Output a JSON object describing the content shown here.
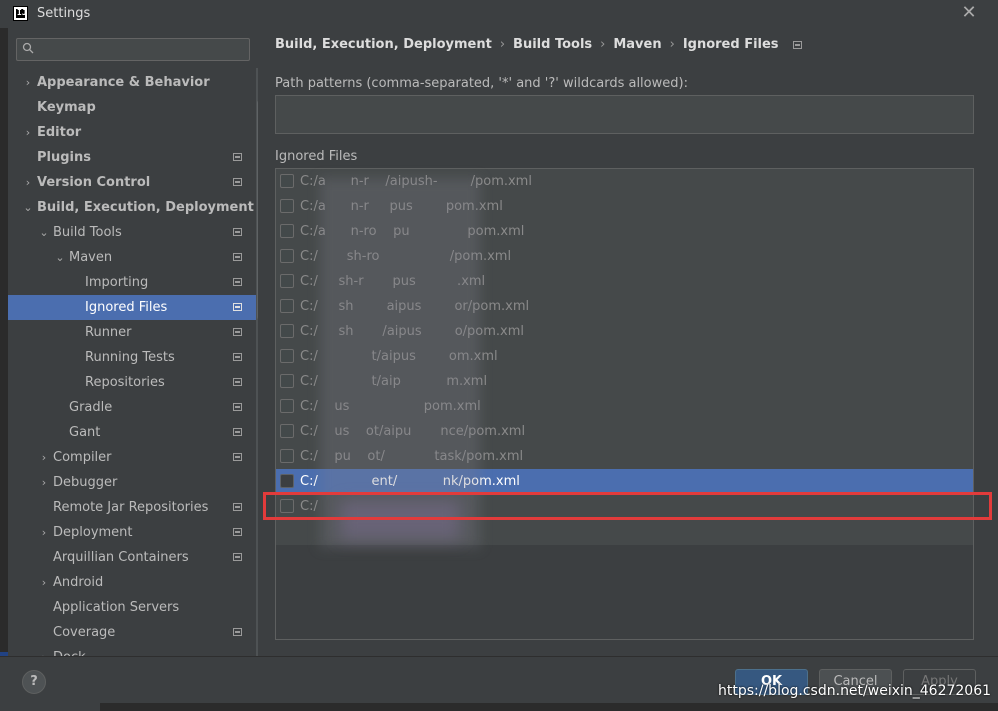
{
  "window": {
    "title": "Settings",
    "close_glyph": "✕"
  },
  "search": {
    "placeholder": "",
    "value": "",
    "icon": "search-icon"
  },
  "sidebar": {
    "items": [
      {
        "label": "Appearance & Behavior",
        "level": 0,
        "arrow": "›",
        "bold": true,
        "icon": false
      },
      {
        "label": "Keymap",
        "level": 0,
        "arrow": "",
        "bold": true,
        "icon": false
      },
      {
        "label": "Editor",
        "level": 0,
        "arrow": "›",
        "bold": true,
        "icon": false
      },
      {
        "label": "Plugins",
        "level": 0,
        "arrow": "",
        "bold": true,
        "icon": true
      },
      {
        "label": "Version Control",
        "level": 0,
        "arrow": "›",
        "bold": true,
        "icon": true
      },
      {
        "label": "Build, Execution, Deployment",
        "level": 0,
        "arrow": "⌄",
        "bold": true,
        "icon": false
      },
      {
        "label": "Build Tools",
        "level": 1,
        "arrow": "⌄",
        "bold": false,
        "icon": true
      },
      {
        "label": "Maven",
        "level": 2,
        "arrow": "⌄",
        "bold": false,
        "icon": true
      },
      {
        "label": "Importing",
        "level": 3,
        "arrow": "",
        "bold": false,
        "icon": true
      },
      {
        "label": "Ignored Files",
        "level": 3,
        "arrow": "",
        "bold": false,
        "icon": true,
        "selected": true
      },
      {
        "label": "Runner",
        "level": 3,
        "arrow": "",
        "bold": false,
        "icon": true
      },
      {
        "label": "Running Tests",
        "level": 3,
        "arrow": "",
        "bold": false,
        "icon": true
      },
      {
        "label": "Repositories",
        "level": 3,
        "arrow": "",
        "bold": false,
        "icon": true
      },
      {
        "label": "Gradle",
        "level": 2,
        "arrow": "",
        "bold": false,
        "icon": true
      },
      {
        "label": "Gant",
        "level": 2,
        "arrow": "",
        "bold": false,
        "icon": true
      },
      {
        "label": "Compiler",
        "level": 1,
        "arrow": "›",
        "bold": false,
        "icon": true
      },
      {
        "label": "Debugger",
        "level": 1,
        "arrow": "›",
        "bold": false,
        "icon": false
      },
      {
        "label": "Remote Jar Repositories",
        "level": 1,
        "arrow": "",
        "bold": false,
        "icon": true
      },
      {
        "label": "Deployment",
        "level": 1,
        "arrow": "›",
        "bold": false,
        "icon": true
      },
      {
        "label": "Arquillian Containers",
        "level": 1,
        "arrow": "",
        "bold": false,
        "icon": true
      },
      {
        "label": "Android",
        "level": 1,
        "arrow": "›",
        "bold": false,
        "icon": false
      },
      {
        "label": "Application Servers",
        "level": 1,
        "arrow": "",
        "bold": false,
        "icon": false
      },
      {
        "label": "Coverage",
        "level": 1,
        "arrow": "",
        "bold": false,
        "icon": true
      },
      {
        "label": "Dock",
        "level": 1,
        "arrow": "›",
        "bold": false,
        "icon": false
      }
    ]
  },
  "breadcrumb": {
    "items": [
      "Build, Execution, Deployment",
      "Build Tools",
      "Maven",
      "Ignored Files"
    ],
    "separator": "›"
  },
  "patterns": {
    "label": "Path patterns (comma-separated, '*' and '?' wildcards allowed):",
    "value": ""
  },
  "ignored": {
    "label": "Ignored Files",
    "files": [
      {
        "path": "C:/a      n-r    /aipush-        /pom.xml",
        "checked": false
      },
      {
        "path": "C:/a      n-r     pus        pom.xml",
        "checked": false
      },
      {
        "path": "C:/a      n-ro    pu              pom.xml",
        "checked": false
      },
      {
        "path": "C:/       sh-ro                 /pom.xml",
        "checked": false
      },
      {
        "path": "C:/     sh-r       pus          .xml",
        "checked": false
      },
      {
        "path": "C:/     sh        aipus        or/pom.xml",
        "checked": false
      },
      {
        "path": "C:/     sh       /aipus        o/pom.xml",
        "checked": false
      },
      {
        "path": "C:/             t/aipus        om.xml",
        "checked": false
      },
      {
        "path": "C:/             t/aip           m.xml",
        "checked": false
      },
      {
        "path": "C:/    us                  pom.xml",
        "checked": false
      },
      {
        "path": "C:/    us    ot/aipu       nce/pom.xml",
        "checked": false
      },
      {
        "path": "C:/    pu    ot/            task/pom.xml",
        "checked": false
      },
      {
        "path": "C:/             ent/           nk/pom.xml",
        "checked": false,
        "selected": true
      },
      {
        "path": "C:/                           ",
        "checked": false
      }
    ]
  },
  "footer": {
    "help": "?",
    "ok": "OK",
    "cancel": "Cancel",
    "apply": "Apply",
    "watermark": "https://blog.csdn.net/weixin_46272061"
  },
  "colors": {
    "background": "#3c3f41",
    "selection": "#4b6eaf",
    "highlight_border": "#e23b3b",
    "ok_button": "#365880"
  }
}
